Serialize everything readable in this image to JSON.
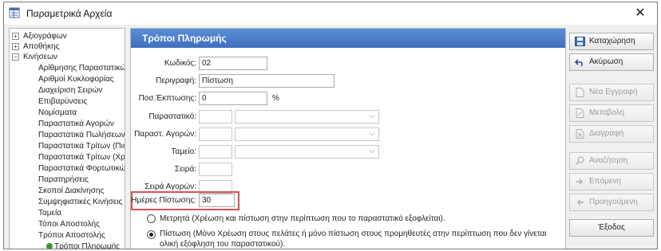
{
  "window": {
    "title": "Παραμετρικά Αρχεία",
    "close_glyph": "✕"
  },
  "tree": {
    "roots": [
      {
        "label": "Αξιογράφων",
        "expander": "+"
      },
      {
        "label": "Αποθήκης",
        "expander": "+"
      },
      {
        "label": "Κινήσεων",
        "expander": "−"
      }
    ],
    "children": [
      "Αρίθμησης Παραστατικών",
      "Αριθμοί Κυκλοφορίας",
      "Διαχείριση Σειρών",
      "Επιβαρύνσεις",
      "Νομίσματα",
      "Παραστατικά Αγορών",
      "Παραστατικά Πωλήσεων",
      "Παραστατικά Τρίτων (Πιστ.",
      "Παραστατικά Τρίτων (Χρ.)",
      "Παραστατικά Φορτωτικών",
      "Παρατηρήσεις",
      "Σκοποί Διακίνησης",
      "Συμψηφιστικές Κινήσεις",
      "Ταμεία",
      "Τόποι Αποστολής",
      "Τρόποι Αποστολής",
      "Τρόποι Πληρωμής"
    ]
  },
  "form": {
    "header": "Τρόποι Πληρωμής",
    "code_label": "Κωδικός:",
    "code_value": "02",
    "description_label": "Περιγραφή:",
    "description_value": "Πίστωση",
    "discount_label": "Ποσ.Έκπτωσης:",
    "discount_value": "0",
    "discount_unit": "%",
    "document_label": "Παραστατικό:",
    "purchase_doc_label": "Παραστ. Αγορών:",
    "cashbox_label": "Ταμείο:",
    "series_label": "Σειρά:",
    "purchase_series_label": "Σειρά Αγορών:",
    "credit_days_label": "Ημέρες Πίστωσης:",
    "credit_days_value": "30",
    "radio_cash": "Μετρητά (Χρέωση και πίστωση στην περίπτωση που το παραστατικό εξοφλείται).",
    "radio_credit_line1": "Πίστωση (Μόνο Χρέωση στους πελάτες ή μόνο πίστωση στους προμηθευτές στην περίπτωση που δεν γίνεται",
    "radio_credit_line2": "ολική εξόφληση του παραστατικού).",
    "selected_radio": "credit",
    "highlight_color": "#d9534f"
  },
  "actions": {
    "save": "Καταχώρηση",
    "cancel": "Ακύρωση",
    "new": "Νέα Εγγραφή",
    "edit": "Μεταβολή",
    "delete": "Διαγραφή",
    "search": "Αναζήτηση",
    "next": "Επόμενη",
    "previous": "Προηγούμενη",
    "exit": "Έξοδος"
  },
  "colors": {
    "header": "#4a7bca",
    "accent_red": "#d9534f"
  }
}
